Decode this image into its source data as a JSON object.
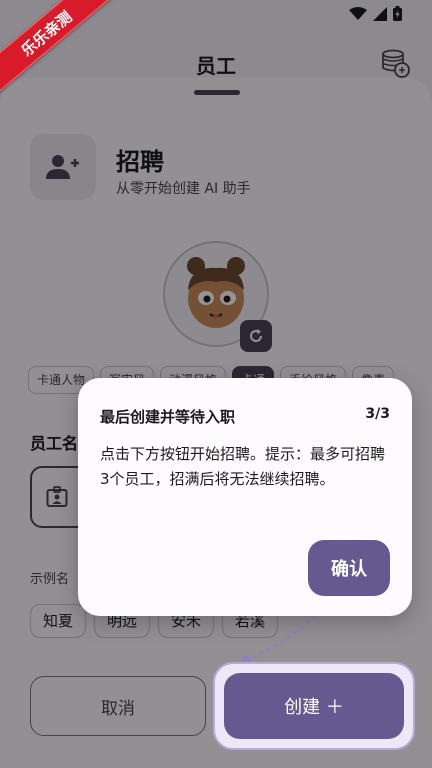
{
  "watermark": "乐乐亲测",
  "header": {
    "title": "员工",
    "coins_icon": "coins-stack-icon"
  },
  "sheet": {
    "hire_title": "招聘",
    "hire_subtitle": "从零开始创建 AI 助手",
    "style_chips": [
      {
        "label": "卡通人物",
        "selected": false
      },
      {
        "label": "写实风",
        "selected": false
      },
      {
        "label": "动漫风格",
        "selected": false
      },
      {
        "label": "卡通",
        "selected": true
      },
      {
        "label": "手绘风格",
        "selected": false
      },
      {
        "label": "像素",
        "selected": false
      }
    ],
    "name_section_label": "员工名",
    "example_label": "示例名",
    "example_names": [
      "知夏",
      "明远",
      "安禾",
      "若溪"
    ],
    "cancel_label": "取消",
    "create_label": "创建 ＋"
  },
  "dialog": {
    "title": "最后创建并等待入职",
    "step": "3/3",
    "body": "点击下方按钮开始招聘。提示：最多可招聘3个员工，招满后将无法继续招聘。",
    "confirm_label": "确认"
  },
  "colors": {
    "primary": "#655a8f",
    "ribbon": "#d81b2a",
    "surface": "#fbf8fd"
  }
}
